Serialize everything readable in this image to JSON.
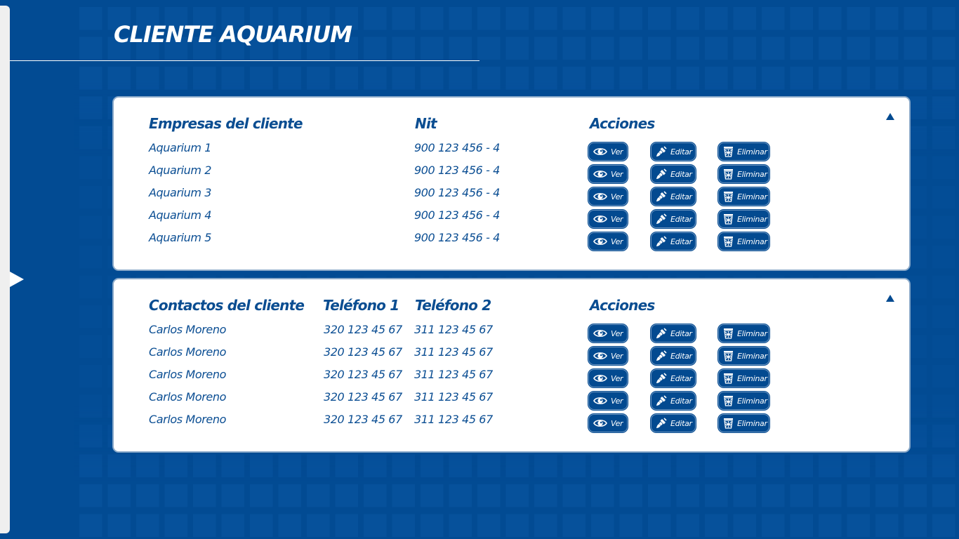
{
  "page": {
    "title": "CLIENTE AQUARIUM"
  },
  "companies": {
    "headers": {
      "name": "Empresas del cliente",
      "nit": "Nit",
      "actions": "Acciones"
    },
    "rows": [
      {
        "name": "Aquarium 1",
        "nit": "900 123 456 - 4"
      },
      {
        "name": "Aquarium 2",
        "nit": "900 123 456 - 4"
      },
      {
        "name": "Aquarium 3",
        "nit": "900 123 456 - 4"
      },
      {
        "name": "Aquarium 4",
        "nit": "900 123 456 - 4"
      },
      {
        "name": "Aquarium 5",
        "nit": "900 123 456 - 4"
      }
    ]
  },
  "contacts": {
    "headers": {
      "name": "Contactos del cliente",
      "phone1": "Teléfono 1",
      "phone2": "Teléfono 2",
      "actions": "Acciones"
    },
    "rows": [
      {
        "name": "Carlos Moreno",
        "phone1": "320 123 45 67",
        "phone2": "311 123 45 67"
      },
      {
        "name": "Carlos Moreno",
        "phone1": "320 123 45 67",
        "phone2": "311 123 45 67"
      },
      {
        "name": "Carlos Moreno",
        "phone1": "320 123 45 67",
        "phone2": "311 123 45 67"
      },
      {
        "name": "Carlos Moreno",
        "phone1": "320 123 45 67",
        "phone2": "311 123 45 67"
      },
      {
        "name": "Carlos Moreno",
        "phone1": "320 123 45 67",
        "phone2": "311 123 45 67"
      }
    ]
  },
  "actions": {
    "view": "Ver",
    "edit": "Editar",
    "delete": "Eliminar"
  },
  "icons": {
    "view": "eye-icon",
    "edit": "paintbrush-icon",
    "delete": "trash-basket-icon",
    "collapse": "triangle-up-icon",
    "sidebar_toggle": "triangle-right-icon"
  },
  "colors": {
    "background": "#024b93",
    "panel": "#ffffff",
    "text": "#0a4d91",
    "button": "#034a90"
  }
}
